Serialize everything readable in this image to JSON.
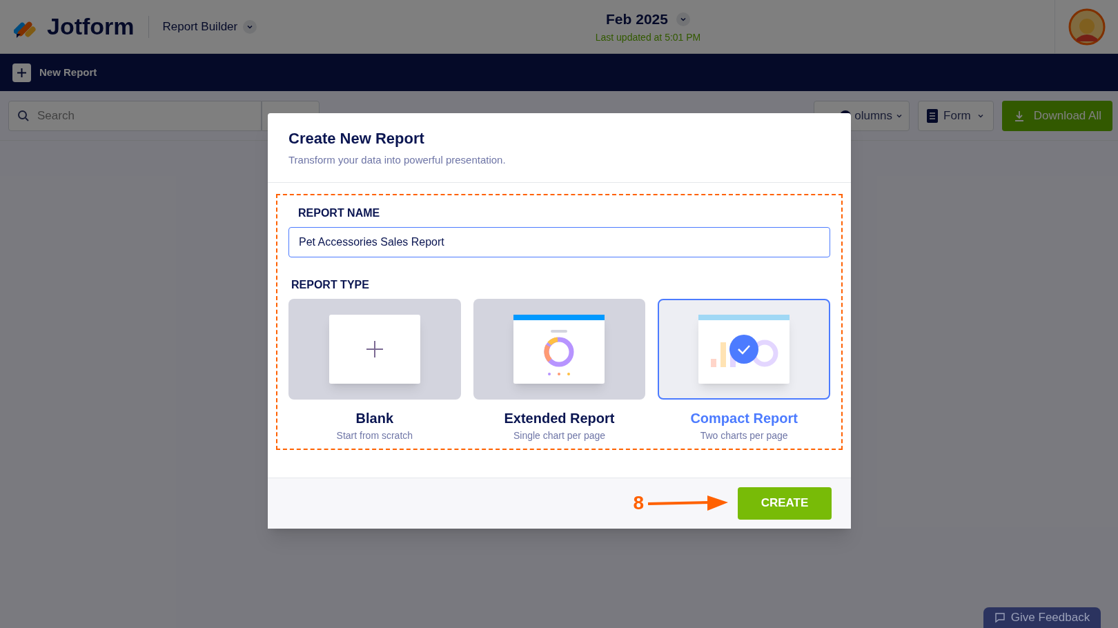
{
  "header": {
    "brand": "Jotform",
    "app_menu": "Report Builder",
    "period": "Feb 2025",
    "last_updated": "Last updated at 5:01 PM"
  },
  "nav": {
    "new_report": "New Report"
  },
  "toolbar": {
    "search_placeholder": "Search",
    "buttons": [
      {
        "kind": "columns",
        "label": "olumns"
      },
      {
        "kind": "form",
        "label": "Form"
      },
      {
        "kind": "download",
        "label": "Download All"
      }
    ]
  },
  "dialog": {
    "title": "Create New Report",
    "subtitle": "Transform your data into powerful presentation.",
    "name_label": "REPORT NAME",
    "name_value": "Pet Accessories Sales Report",
    "type_label": "REPORT TYPE",
    "types": [
      {
        "kind": "blank",
        "title": "Blank",
        "description": "Start from scratch",
        "selected": false
      },
      {
        "kind": "extended",
        "title": "Extended Report",
        "description": "Single chart per page",
        "selected": false
      },
      {
        "kind": "compact",
        "title": "Compact Report",
        "description": "Two charts per page",
        "selected": true
      }
    ],
    "create": "CREATE",
    "step_marker": "8"
  },
  "feedback": "Give Feedback"
}
